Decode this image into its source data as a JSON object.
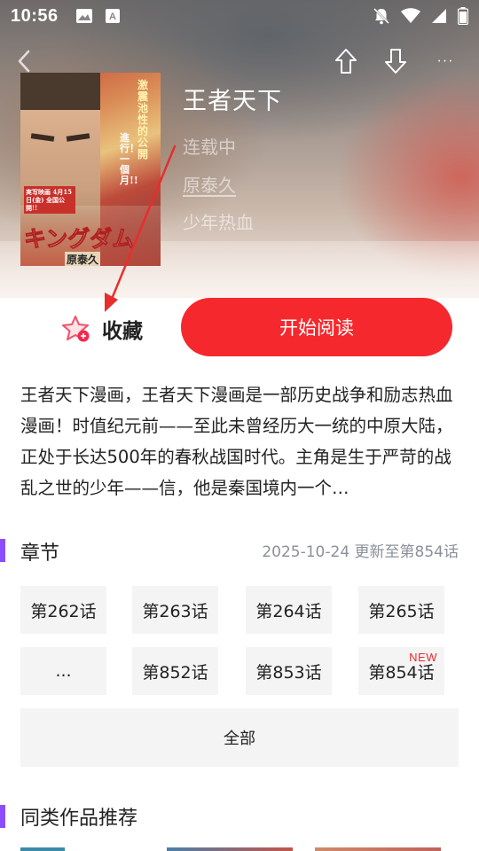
{
  "status_bar": {
    "time": "10:56",
    "icons_left": [
      "image-icon",
      "a-icon"
    ],
    "icons_right": [
      "bell-off-icon",
      "wifi-icon",
      "signal-icon",
      "battery-icon"
    ]
  },
  "nav": {
    "back_icon": "chevron-left-icon",
    "actions": [
      "share-up-icon",
      "download-icon",
      "more-icon"
    ],
    "more_label": "···"
  },
  "comic": {
    "title": "王者天下",
    "status": "连载中",
    "author": "原泰久",
    "genre": "少年热血",
    "cover_text_main": "キングダム",
    "cover_text_author": "原泰久",
    "cover_text_side": "進行！一個月!!",
    "cover_text_badge": "実写映画 4月15日(金) 全国公開!!",
    "cover_text_top": "激震池性的公開"
  },
  "actions": {
    "collect_label": "收藏",
    "read_label": "开始阅读"
  },
  "description": "王者天下漫画，王者天下漫画是一部历史战争和励志热血漫画！时值纪元前——至此未曾经历大一统的中原大陆，正处于长达500年的春秋战国时代。主角是生于严苛的战乱之世的少年——信，他是秦国境内一个…",
  "chapters_section": {
    "title": "章节",
    "update": "2025-10-24 更新至第854话",
    "items": [
      {
        "label": "第262话",
        "new": ""
      },
      {
        "label": "第263话",
        "new": ""
      },
      {
        "label": "第264话",
        "new": ""
      },
      {
        "label": "第265话",
        "new": ""
      },
      {
        "label": "...",
        "new": ""
      },
      {
        "label": "第852话",
        "new": ""
      },
      {
        "label": "第853话",
        "new": ""
      },
      {
        "label": "第854话",
        "new": "NEW"
      }
    ],
    "all_label": "全部"
  },
  "recommend_section": {
    "title": "同类作品推荐"
  },
  "colors": {
    "accent_red": "#f5282d",
    "section_purple": "#8b4dff",
    "chip_bg": "#f4f4f4",
    "muted_text": "#8a8f99"
  }
}
